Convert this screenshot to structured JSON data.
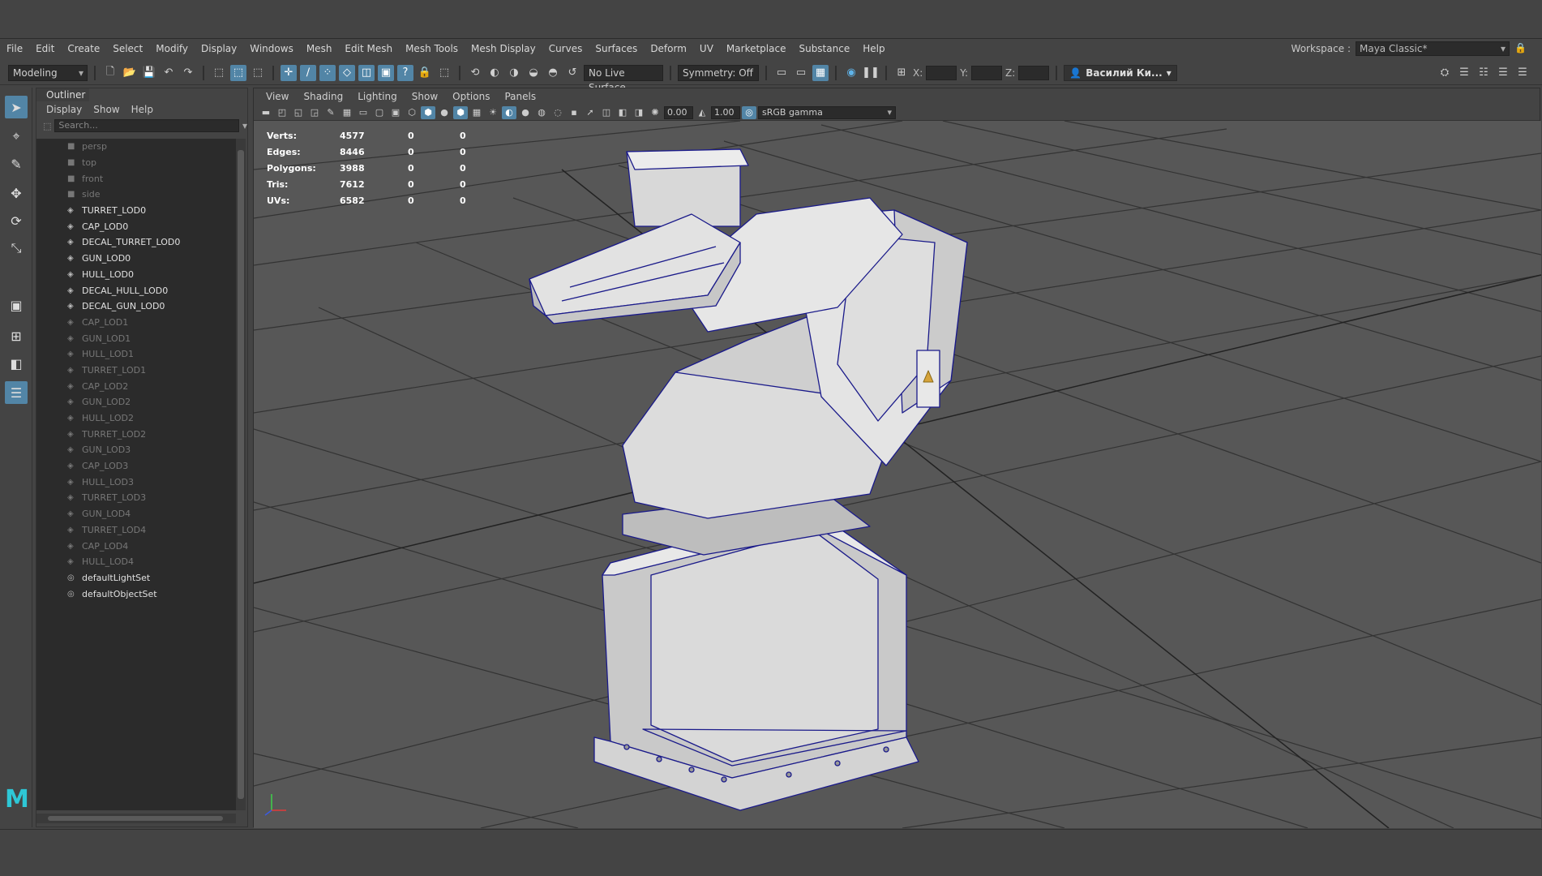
{
  "menubar": {
    "items": [
      "File",
      "Edit",
      "Create",
      "Select",
      "Modify",
      "Display",
      "Windows",
      "Mesh",
      "Edit Mesh",
      "Mesh Tools",
      "Mesh Display",
      "Curves",
      "Surfaces",
      "Deform",
      "UV",
      "Marketplace",
      "Substance",
      "Help"
    ],
    "workspace_label": "Workspace :",
    "workspace_value": "Maya Classic*"
  },
  "toolbar": {
    "mode": "Modeling",
    "live_surface": "No Live Surface",
    "symmetry": "Symmetry: Off",
    "x_label": "X:",
    "y_label": "Y:",
    "z_label": "Z:",
    "user": "Василий Ки..."
  },
  "outliner": {
    "title": "Outliner",
    "menu": [
      "Display",
      "Show",
      "Help"
    ],
    "search_placeholder": "Search...",
    "items": [
      {
        "label": "persp",
        "icon": "camera-icon",
        "dim": true
      },
      {
        "label": "top",
        "icon": "camera-icon",
        "dim": true
      },
      {
        "label": "front",
        "icon": "camera-icon",
        "dim": true
      },
      {
        "label": "side",
        "icon": "camera-icon",
        "dim": true
      },
      {
        "label": "TURRET_LOD0",
        "icon": "transform-icon",
        "dim": false
      },
      {
        "label": "CAP_LOD0",
        "icon": "transform-icon",
        "dim": false
      },
      {
        "label": "DECAL_TURRET_LOD0",
        "icon": "transform-icon",
        "dim": false
      },
      {
        "label": "GUN_LOD0",
        "icon": "transform-icon",
        "dim": false
      },
      {
        "label": "HULL_LOD0",
        "icon": "transform-icon",
        "dim": false
      },
      {
        "label": "DECAL_HULL_LOD0",
        "icon": "transform-icon",
        "dim": false
      },
      {
        "label": "DECAL_GUN_LOD0",
        "icon": "transform-icon",
        "dim": false
      },
      {
        "label": "CAP_LOD1",
        "icon": "transform-icon",
        "dim": true
      },
      {
        "label": "GUN_LOD1",
        "icon": "transform-icon",
        "dim": true
      },
      {
        "label": "HULL_LOD1",
        "icon": "transform-icon",
        "dim": true
      },
      {
        "label": "TURRET_LOD1",
        "icon": "transform-icon",
        "dim": true
      },
      {
        "label": "CAP_LOD2",
        "icon": "transform-icon",
        "dim": true
      },
      {
        "label": "GUN_LOD2",
        "icon": "transform-icon",
        "dim": true
      },
      {
        "label": "HULL_LOD2",
        "icon": "transform-icon",
        "dim": true
      },
      {
        "label": "TURRET_LOD2",
        "icon": "transform-icon",
        "dim": true
      },
      {
        "label": "GUN_LOD3",
        "icon": "transform-icon",
        "dim": true
      },
      {
        "label": "CAP_LOD3",
        "icon": "transform-icon",
        "dim": true
      },
      {
        "label": "HULL_LOD3",
        "icon": "transform-icon",
        "dim": true
      },
      {
        "label": "TURRET_LOD3",
        "icon": "transform-icon",
        "dim": true
      },
      {
        "label": "GUN_LOD4",
        "icon": "transform-icon",
        "dim": true
      },
      {
        "label": "TURRET_LOD4",
        "icon": "transform-icon",
        "dim": true
      },
      {
        "label": "CAP_LOD4",
        "icon": "transform-icon",
        "dim": true
      },
      {
        "label": "HULL_LOD4",
        "icon": "transform-icon",
        "dim": true
      },
      {
        "label": "defaultLightSet",
        "icon": "set-icon",
        "dim": false
      },
      {
        "label": "defaultObjectSet",
        "icon": "set-icon",
        "dim": false
      }
    ]
  },
  "viewport": {
    "menu": [
      "View",
      "Shading",
      "Lighting",
      "Show",
      "Options",
      "Panels"
    ],
    "exposure": "0.00",
    "gamma": "1.00",
    "color_space": "sRGB gamma",
    "hud": [
      {
        "label": "Verts:",
        "value": "4577",
        "c1": "0",
        "c2": "0"
      },
      {
        "label": "Edges:",
        "value": "8446",
        "c1": "0",
        "c2": "0"
      },
      {
        "label": "Polygons:",
        "value": "3988",
        "c1": "0",
        "c2": "0"
      },
      {
        "label": "Tris:",
        "value": "7612",
        "c1": "0",
        "c2": "0"
      },
      {
        "label": "UVs:",
        "value": "6582",
        "c1": "0",
        "c2": "0"
      }
    ]
  },
  "colors": {
    "accent": "#5285a6",
    "wire": "#1a1a8a",
    "logo": "#2ec7d6"
  }
}
